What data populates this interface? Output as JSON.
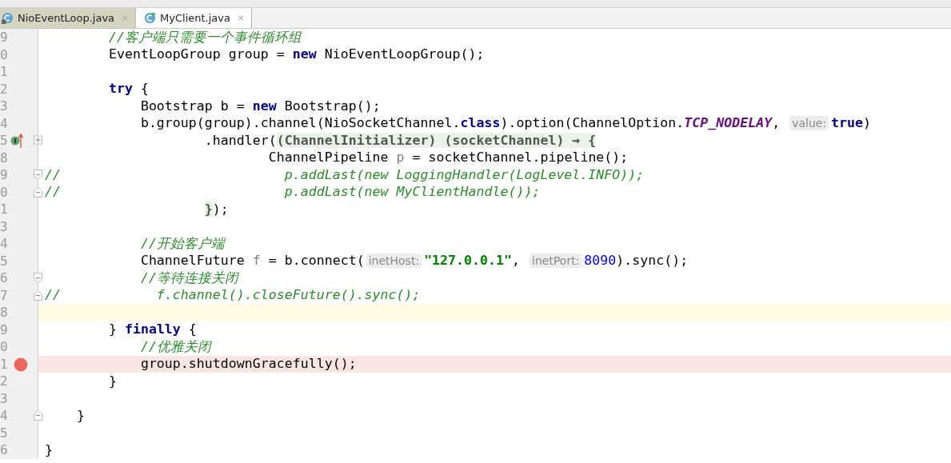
{
  "tabs": [
    {
      "label": "NioEventLoop.java",
      "selected": false,
      "locked": true
    },
    {
      "label": "MyClient.java",
      "selected": true,
      "locked": false
    }
  ],
  "editor": {
    "lines": [
      {
        "number": "9",
        "tokens": [
          {
            "t": "        //客户端只需要一个事件循环组",
            "kind": "comment"
          }
        ]
      },
      {
        "number": "0",
        "tokens": [
          {
            "t": "        EventLoopGroup group = "
          },
          {
            "t": "new",
            "kind": "keyword"
          },
          {
            "t": " NioEventLoopGroup();"
          }
        ]
      },
      {
        "number": "1"
      },
      {
        "number": "2",
        "tokens": [
          {
            "t": "        try",
            "kind": "keyword"
          },
          {
            "t": " {"
          }
        ]
      },
      {
        "number": "3",
        "tokens": [
          {
            "t": "            Bootstrap b = "
          },
          {
            "t": "new",
            "kind": "keyword"
          },
          {
            "t": " Bootstrap();"
          }
        ]
      },
      {
        "number": "4",
        "tokens": [
          {
            "t": "            b.group(group).channel(NioSocketChannel."
          },
          {
            "t": "class",
            "kind": "keyword"
          },
          {
            "t": ").option(ChannelOption."
          },
          {
            "t": "TCP_NODELAY",
            "kind": "constant"
          },
          {
            "t": ", "
          },
          {
            "t": "value:",
            "kind": "hint"
          },
          {
            "t": "true",
            "kind": "keyword"
          },
          {
            "t": ")"
          }
        ]
      },
      {
        "number": "5",
        "gutter_icons": [
          {
            "kind": "implemented"
          },
          {
            "kind": "arrow"
          }
        ],
        "fold": {
          "kind": "plus"
        },
        "tokens": [
          {
            "t": "                    .handler("
          },
          {
            "t": "(ChannelInitializer) (socketChannel) → {",
            "kind": "folded"
          }
        ]
      },
      {
        "number": "8",
        "tokens": [
          {
            "t": "                            ChannelPipeline "
          },
          {
            "t": "p",
            "kind": "unused"
          },
          {
            "t": " = socketChannel.pipeline();"
          }
        ]
      },
      {
        "number": "9",
        "fold": {
          "kind": "start"
        },
        "tokens": [
          {
            "t": "//                            p.addLast(new LoggingHandler(LogLevel.INFO));",
            "kind": "comment"
          }
        ]
      },
      {
        "number": "0",
        "fold": {
          "kind": "end"
        },
        "tokens": [
          {
            "t": "//                            p.addLast(new MyClientHandle());",
            "kind": "comment"
          }
        ]
      },
      {
        "number": "1",
        "tokens": [
          {
            "t": "                    }",
            "kind": "folded"
          },
          {
            "t": ");"
          }
        ]
      },
      {
        "number": "3"
      },
      {
        "number": "4",
        "tokens": [
          {
            "t": "            //开始客户端",
            "kind": "comment"
          }
        ]
      },
      {
        "number": "5",
        "tokens": [
          {
            "t": "            ChannelFuture "
          },
          {
            "t": "f",
            "kind": "unused"
          },
          {
            "t": " = b.connect("
          },
          {
            "t": "inetHost:",
            "kind": "hint"
          },
          {
            "t": "\"127.0.0.1\"",
            "kind": "string"
          },
          {
            "t": ", "
          },
          {
            "t": "inetPort:",
            "kind": "hint"
          },
          {
            "t": "8090",
            "kind": "number"
          },
          {
            "t": ").sync();"
          }
        ]
      },
      {
        "number": "6",
        "fold": {
          "kind": "start"
        },
        "tokens": [
          {
            "t": "            //等待连接关闭",
            "kind": "comment"
          }
        ]
      },
      {
        "number": "7",
        "fold": {
          "kind": "end"
        },
        "tokens": [
          {
            "t": "//            f.channel().closeFuture().sync();",
            "kind": "comment"
          }
        ]
      },
      {
        "number": "8",
        "highlight": {
          "kind": "current"
        }
      },
      {
        "number": "9",
        "tokens": [
          {
            "t": "        } "
          },
          {
            "t": "finally",
            "kind": "keyword"
          },
          {
            "t": " {"
          }
        ]
      },
      {
        "number": "0",
        "tokens": [
          {
            "t": "            //优雅关闭",
            "kind": "comment"
          }
        ]
      },
      {
        "number": "1",
        "highlight": {
          "kind": "breakpoint"
        },
        "gutter_icons": [
          {
            "kind": "breakpoint"
          }
        ],
        "tokens": [
          {
            "t": "            group.shutdownGracefully();"
          }
        ]
      },
      {
        "number": "2",
        "tokens": [
          {
            "t": "        }"
          }
        ]
      },
      {
        "number": "3"
      },
      {
        "number": "4",
        "fold": {
          "kind": "end"
        },
        "tokens": [
          {
            "t": "    }"
          }
        ]
      },
      {
        "number": "5"
      },
      {
        "number": "6",
        "tokens": [
          {
            "t": "}"
          }
        ]
      }
    ]
  }
}
